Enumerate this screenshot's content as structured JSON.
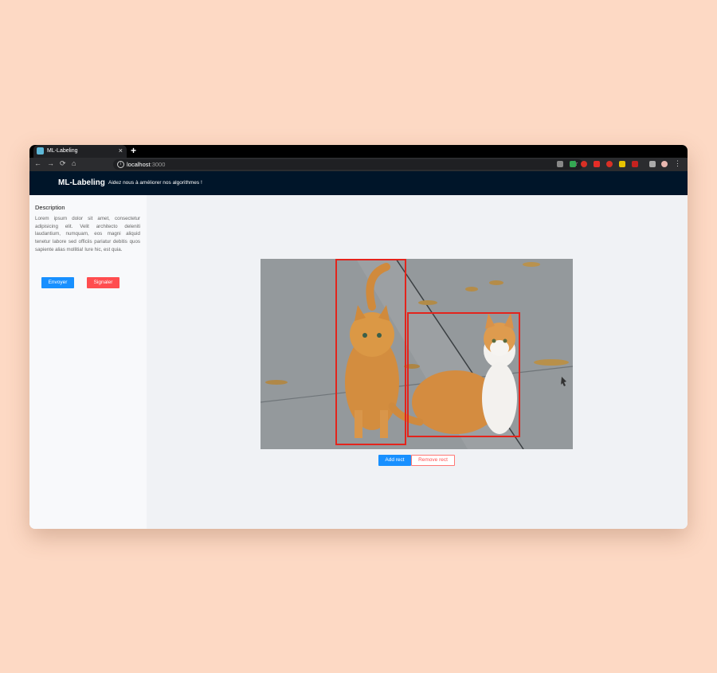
{
  "browser": {
    "tab_title": "ML-Labeling",
    "tab_close": "×",
    "new_tab": "+",
    "url_host": "localhost",
    "url_port": ":3000",
    "icons": [
      "back-icon",
      "forward-icon",
      "reload-icon",
      "home-icon",
      "site-info-icon",
      "bookmark-star-icon",
      "menu-dots-icon"
    ]
  },
  "app": {
    "title": "ML-Labeling",
    "subtitle": "Aidez nous à améliorer nos algorithmes !"
  },
  "sidebar": {
    "description_title": "Description",
    "description_text": "Lorem ipsum dolor sit amet, consectetur adipisicing elit. Velit architecto deleniti laudantium, numquam, eos magni aliquid tenetur labore sed officiis pariatur debitis quos sapiente alias mollitia! Iure hic, est quia.",
    "send_label": "Envoyer",
    "report_label": "Signaler"
  },
  "annotator": {
    "add_label": "Add rect",
    "remove_label": "Remove rect",
    "box_color": "#e3241c"
  },
  "colors": {
    "primary": "#1890ff",
    "danger": "#ff4d4f",
    "header": "#001529",
    "background": "#fdd9c4"
  }
}
